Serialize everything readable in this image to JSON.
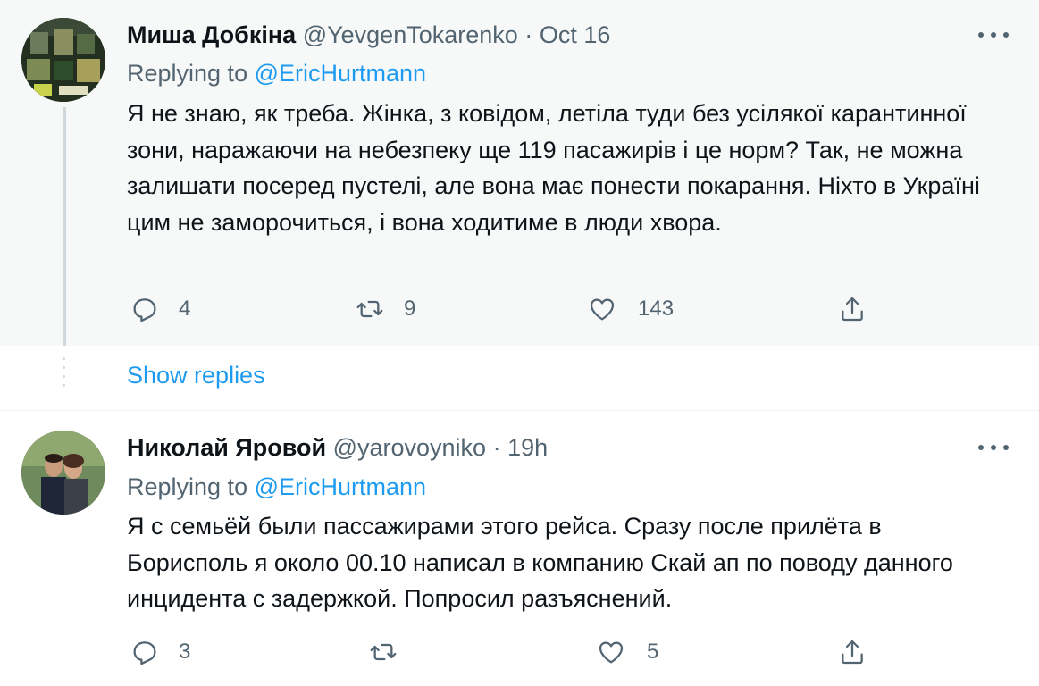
{
  "tweets": [
    {
      "name": "Миша Добкіна",
      "handle": "@YevgenTokarenko",
      "separator": "·",
      "time": "Oct 16",
      "replying_prefix": "Replying to",
      "replying_to": "@EricHurtmann",
      "text": "Я не знаю, як треба. Жінка, з ковідом, летіла туди без усілякої карантинної зони, наражаючи на небезпеку ще 119 пасажирів і це норм? Так, не можна залишати посеред пустелі, але вона має понести покарання. Ніхто в Україні цим не заморочиться, і вона ходитиме в люди хвора.",
      "replies": "4",
      "retweets": "9",
      "likes": "143"
    },
    {
      "name": "Николай Яровой",
      "handle": "@yarovoyniko",
      "separator": "·",
      "time": "19h",
      "replying_prefix": "Replying to",
      "replying_to": "@EricHurtmann",
      "text": "Я с семьёй были пассажирами этого рейса. Сразу после прилёта в Борисполь я около 00.10 написал в компанию Скай ап по поводу данного инцидента с задержкой. Попросил разъяснений.",
      "replies": "3",
      "retweets": "",
      "likes": "5"
    }
  ],
  "show_replies": "Show replies",
  "icons": {
    "reply": "reply-icon",
    "retweet": "retweet-icon",
    "like": "heart-icon",
    "share": "share-icon",
    "more": "more-icon"
  },
  "colors": {
    "accent": "#1d9bf0",
    "secondary_text": "#536471",
    "highlight_bg": "#f7f9f9"
  }
}
